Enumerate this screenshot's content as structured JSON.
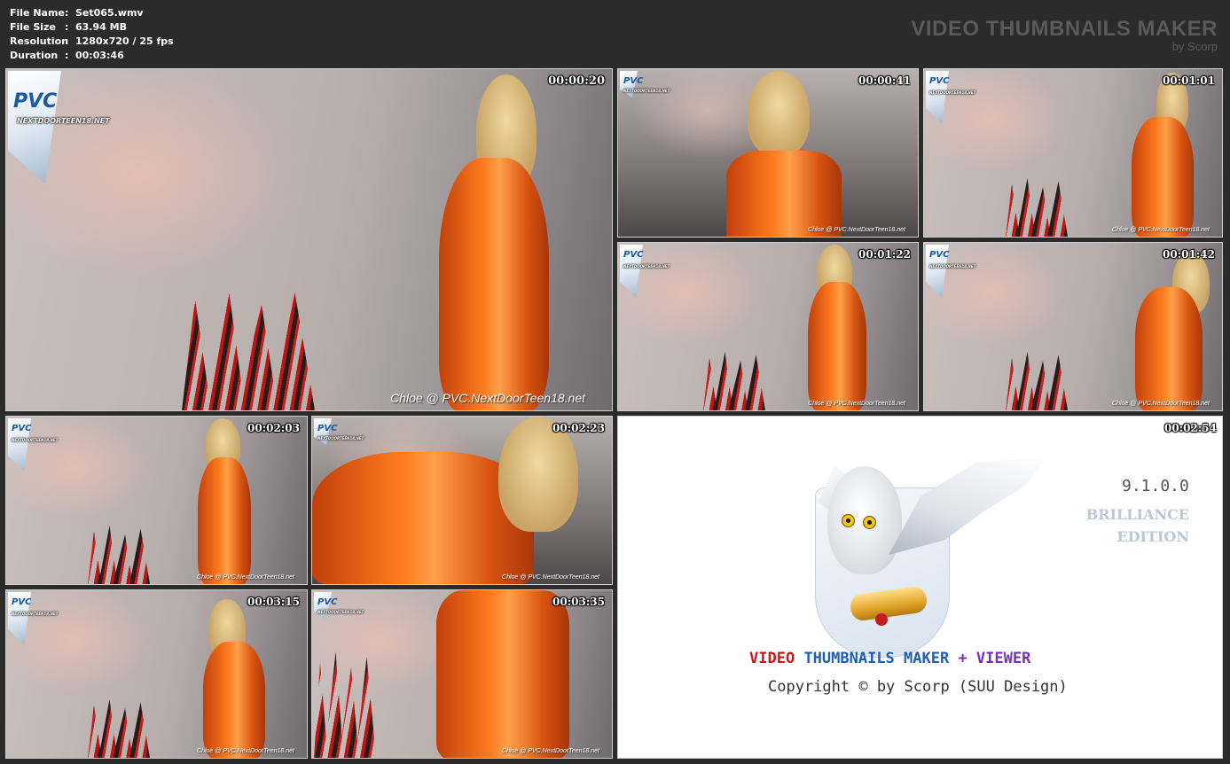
{
  "info": {
    "rows": [
      {
        "key": "File Name",
        "sep": ":",
        "value": "Set065.wmv"
      },
      {
        "key": "File Size",
        "sep": ":",
        "value": "63.94 MB"
      },
      {
        "key": "Resolution",
        "sep": ":",
        "value": "1280x720 / 25 fps"
      },
      {
        "key": "Duration",
        "sep": ":",
        "value": "00:03:46"
      }
    ]
  },
  "brand": {
    "title": "VIDEO THUMBNAILS MAKER",
    "subtitle": "by Scorp"
  },
  "logo": {
    "mark_text": "PVC",
    "site_text": "NEXTDOORTEEN18.NET"
  },
  "thumbnails": [
    {
      "timestamp": "00:00:20",
      "watermark": "Chloe @ PVC.NextDoorTeen18.net"
    },
    {
      "timestamp": "00:00:41",
      "watermark": "Chloe @ PVC.NextDoorTeen18.net"
    },
    {
      "timestamp": "00:01:01",
      "watermark": "Chloe @ PVC.NextDoorTeen18.net"
    },
    {
      "timestamp": "00:01:22",
      "watermark": "Chloe @ PVC.NextDoorTeen18.net"
    },
    {
      "timestamp": "00:01:42",
      "watermark": "Chloe @ PVC.NextDoorTeen18.net"
    },
    {
      "timestamp": "00:02:03",
      "watermark": "Chloe @ PVC.NextDoorTeen18.net"
    },
    {
      "timestamp": "00:02:23",
      "watermark": "Chloe @ PVC.NextDoorTeen18.net"
    },
    {
      "timestamp": "00:03:15",
      "watermark": "Chloe @ PVC.NextDoorTeen18.net"
    },
    {
      "timestamp": "00:03:35",
      "watermark": "Chloe @ PVC.NextDoorTeen18.net"
    }
  ],
  "splash": {
    "timestamp": "00:02:54",
    "version": "9.1.0.0",
    "edition_line1": "BRILLIANCE",
    "edition_line2": "EDITION",
    "title_part1": "VIDEO",
    "title_part2": "THUMBNAILS MAKER",
    "title_part3": "+ VIEWER",
    "copyright": "Copyright © by Scorp (SUU Design)",
    "icon": "owl-icon",
    "colors": {
      "red": "#c81818",
      "blue": "#1f5fb0",
      "purple": "#7a2fb8"
    }
  }
}
